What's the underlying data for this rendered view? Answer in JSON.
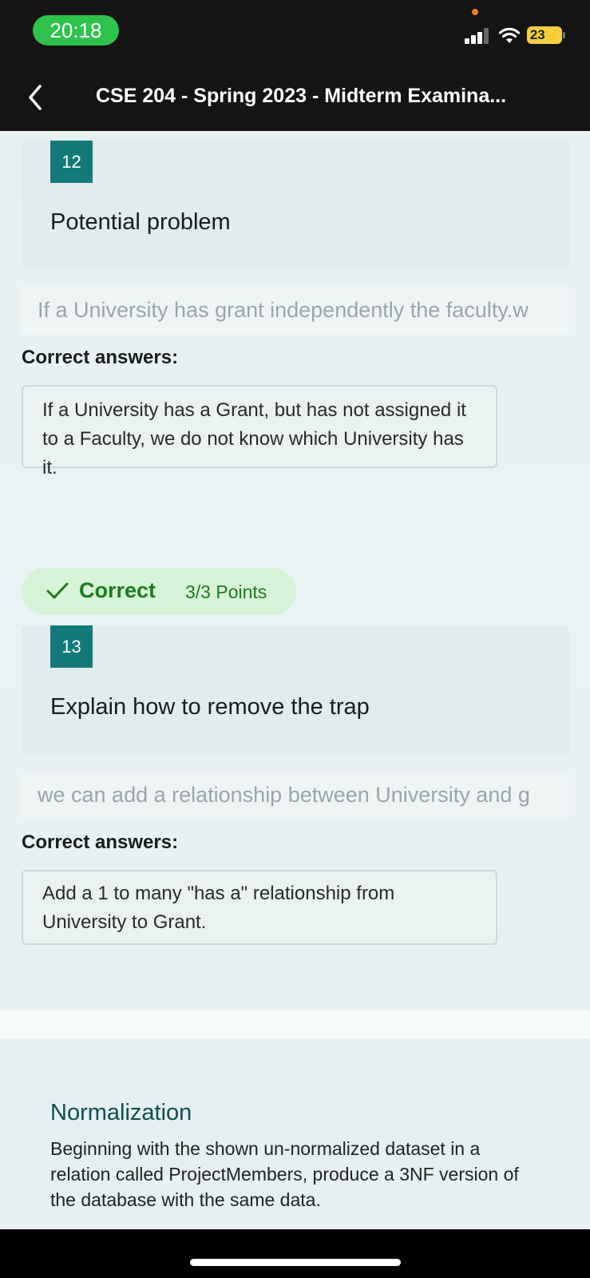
{
  "status": {
    "time": "20:18",
    "battery": "23"
  },
  "header": {
    "title": "CSE 204 - Spring 2023 - Midterm Examina..."
  },
  "questions": [
    {
      "number": "12",
      "text": "Potential problem",
      "response": "If a University has grant independently the faculty.w",
      "correct_label": "Correct answers:",
      "correct_answer": "If a University has a Grant, but has not assigned it to a Faculty, we do not know which University has it."
    },
    {
      "number": "13",
      "text": "Explain how to remove the trap",
      "response": "we can add a relationship between University and g",
      "correct_label": "Correct answers:",
      "correct_answer": "Add a 1 to many \"has a\" relationship from University to Grant.",
      "score": {
        "status": "Correct",
        "points": "3/3 Points"
      }
    }
  ],
  "section": {
    "title": "Normalization",
    "description": "Beginning with the shown un-normalized dataset in a relation called ProjectMembers, produce a 3NF version of the database with the same data."
  },
  "colors": {
    "accent": "#137a7a",
    "success": "#1f7a1f",
    "success_bg": "#d7f3d8",
    "status_pill": "#2fc24d"
  }
}
